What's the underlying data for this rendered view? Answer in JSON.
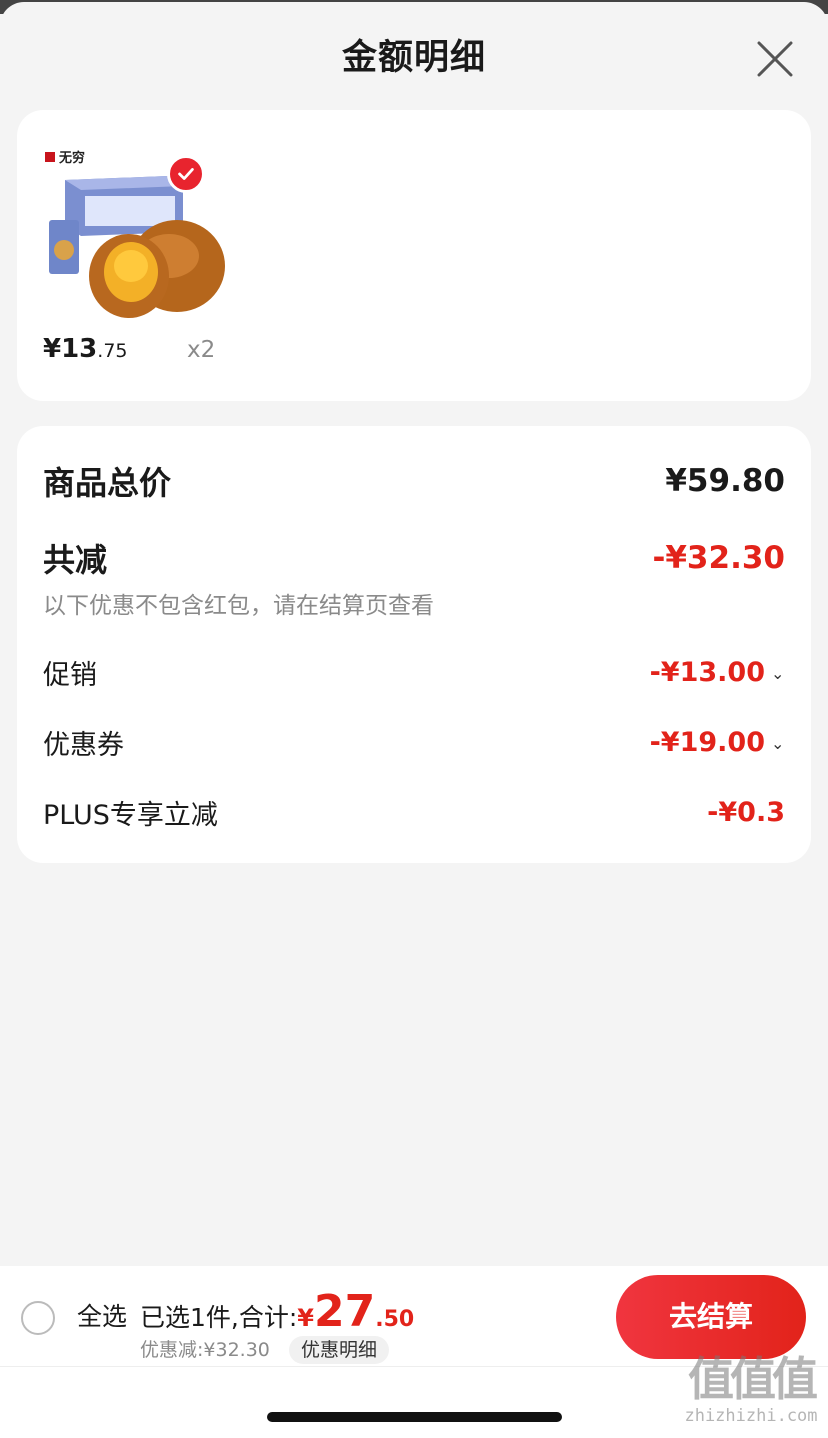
{
  "header": {
    "title": "金额明细"
  },
  "product": {
    "brand": "无穷",
    "price_int": "¥13",
    "price_dec": ".75",
    "quantity": "x2"
  },
  "breakdown": {
    "total_label": "商品总价",
    "total_value": "¥59.80",
    "reduce_label": "共减",
    "reduce_value": "-¥32.30",
    "note": "以下优惠不包含红包，请在结算页查看",
    "items": [
      {
        "label": "促销",
        "value": "-¥13.00",
        "expandable": true
      },
      {
        "label": "优惠券",
        "value": "-¥19.00",
        "expandable": true
      },
      {
        "label": "PLUS专享立减",
        "value": "-¥0.3",
        "expandable": false
      }
    ]
  },
  "footer": {
    "select_all": "全选",
    "selected_text": "已选1件,合计:",
    "total_yen": "¥",
    "total_int": "27",
    "total_dec": ".50",
    "discount_text": "优惠减:¥32.30",
    "detail_link": "优惠明细",
    "checkout": "去结算"
  },
  "watermark": {
    "big": "值值值",
    "small": "zhizhizhi.com"
  },
  "colors": {
    "accent": "#e2231a",
    "muted": "#8a8a8a",
    "background": "#f4f4f4"
  }
}
